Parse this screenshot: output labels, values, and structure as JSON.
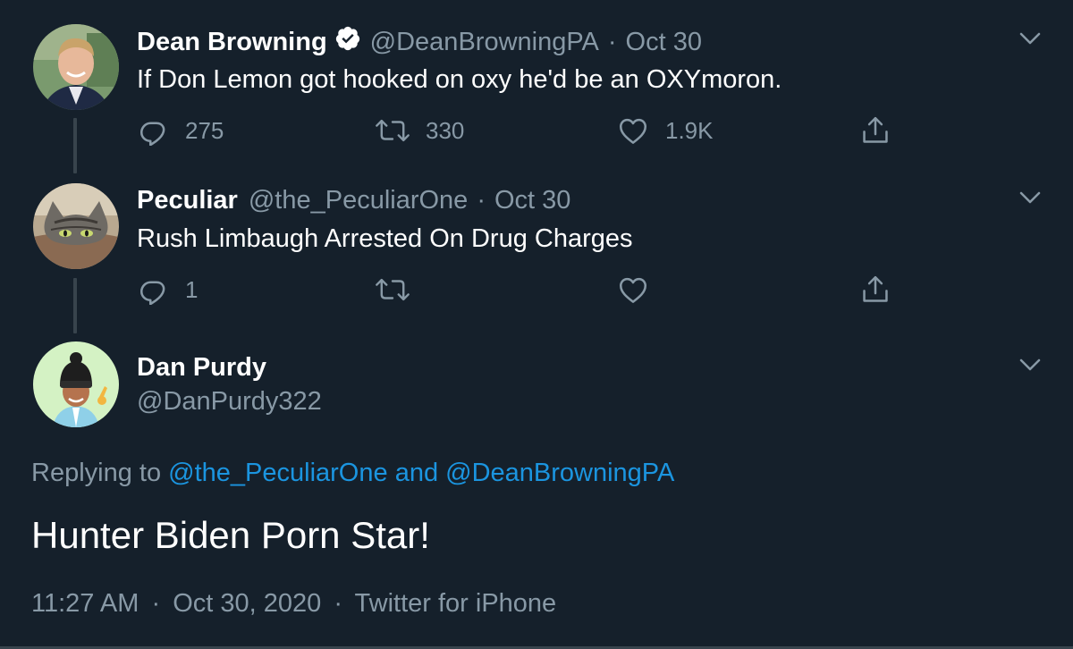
{
  "tweets": [
    {
      "name": "Dean Browning",
      "verified": true,
      "handle": "@DeanBrowningPA",
      "separator": "·",
      "date": "Oct 30",
      "text": "If Don Lemon got hooked on oxy he'd be an OXYmoron.",
      "replies": "275",
      "retweets": "330",
      "likes": "1.9K"
    },
    {
      "name": "Peculiar",
      "verified": false,
      "handle": "@the_PeculiarOne",
      "separator": "·",
      "date": "Oct 30",
      "text": "Rush Limbaugh Arrested On Drug Charges",
      "replies": "1",
      "retweets": "",
      "likes": ""
    }
  ],
  "focused": {
    "name": "Dan Purdy",
    "handle": "@DanPurdy322",
    "replying_prefix": "Replying to",
    "replying_user_1": "@the_PeculiarOne",
    "replying_and": "and",
    "replying_user_2": "@DeanBrowningPA",
    "text": "Hunter Biden Porn Star!",
    "time": "11:27 AM",
    "separator": "·",
    "date": "Oct 30, 2020",
    "source": "Twitter for iPhone"
  },
  "icons": {
    "reply": "reply-icon",
    "retweet": "retweet-icon",
    "like": "heart-icon",
    "share": "share-icon",
    "more": "chevron-down-icon",
    "verified": "verified-badge-icon"
  },
  "colors": {
    "background": "#15202b",
    "text": "#ffffff",
    "muted": "#8899a6",
    "link": "#1b95e0",
    "divider": "#38444d",
    "verified": "#ffffff"
  }
}
